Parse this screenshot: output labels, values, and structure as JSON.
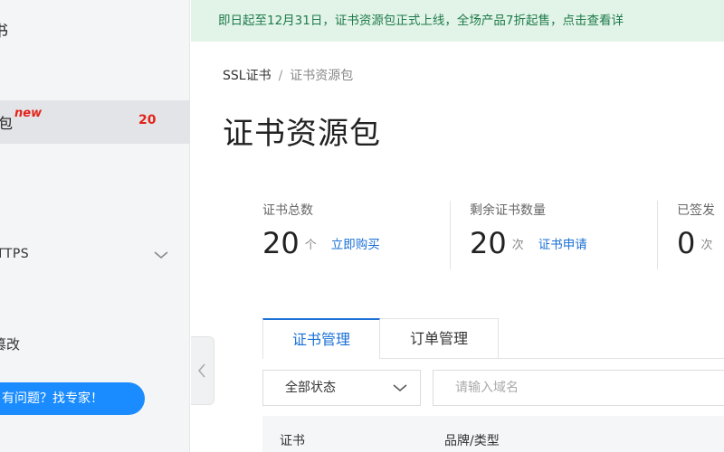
{
  "sidebar": {
    "title": "书",
    "active_item": {
      "label": "包",
      "badge": "new",
      "count": "20"
    },
    "https_item": {
      "label": "TTPS"
    },
    "tamper_item": {
      "label": "篡改"
    },
    "expert_button": "有问题？找专家！"
  },
  "banner": {
    "text": "即日起至12月31日，证书资源包正式上线，全场产品7折起售，点击查看详"
  },
  "breadcrumb": {
    "parent": "SSL证书",
    "separator": "/",
    "current": "证书资源包"
  },
  "page": {
    "title": "证书资源包"
  },
  "stats": [
    {
      "label": "证书总数",
      "value": "20",
      "unit": "个",
      "link": "立即购买"
    },
    {
      "label": "剩余证书数量",
      "value": "20",
      "unit": "次",
      "link": "证书申请"
    },
    {
      "label": "已签发",
      "value": "0",
      "unit": "次"
    }
  ],
  "tabs": [
    {
      "label": "证书管理",
      "active": true
    },
    {
      "label": "订单管理",
      "active": false
    }
  ],
  "filters": {
    "status_select": {
      "value": "全部状态"
    },
    "domain_input": {
      "placeholder": "请输入域名",
      "value": ""
    }
  },
  "table": {
    "columns": [
      "证书",
      "品牌/类型"
    ]
  },
  "colors": {
    "accent": "#1a70d6",
    "badge": "#e2231a",
    "banner_bg": "#e2f4e8",
    "banner_text": "#1e7a4a",
    "expert_button": "#1a8cff"
  }
}
